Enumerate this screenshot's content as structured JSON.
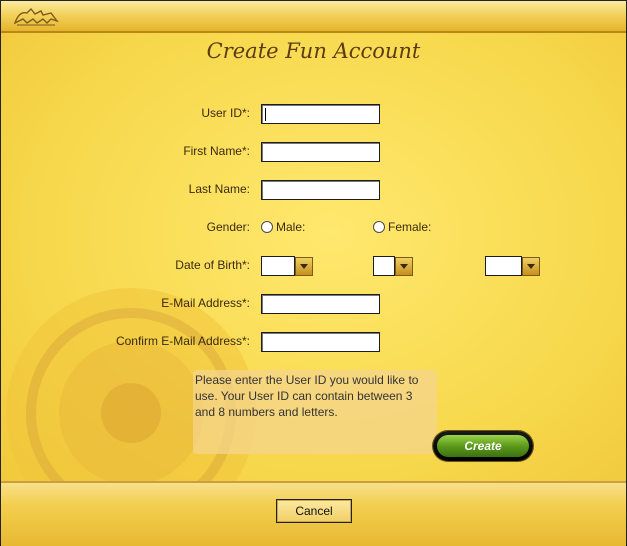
{
  "window": {
    "title": "Create Fun Account"
  },
  "form": {
    "user_id_label": "User ID*:",
    "first_name_label": "First Name*:",
    "last_name_label": "Last Name:",
    "gender_label": "Gender:",
    "male_label": "Male:",
    "female_label": "Female:",
    "dob_label": "Date of Birth*:",
    "email_label": "E-Mail Address*:",
    "confirm_email_label": "Confirm E-Mail Address*:",
    "user_id_value": "",
    "first_name_value": "",
    "last_name_value": "",
    "email_value": "",
    "confirm_email_value": ""
  },
  "hint": "Please enter the User ID you would like to use. Your User ID can contain between 3 and 8 numbers and letters.",
  "buttons": {
    "create": "Create",
    "cancel": "Cancel"
  },
  "colors": {
    "accent_gold": "#f6d84a",
    "title_brown": "#5b3c12",
    "create_green": "#5c9a1c"
  }
}
